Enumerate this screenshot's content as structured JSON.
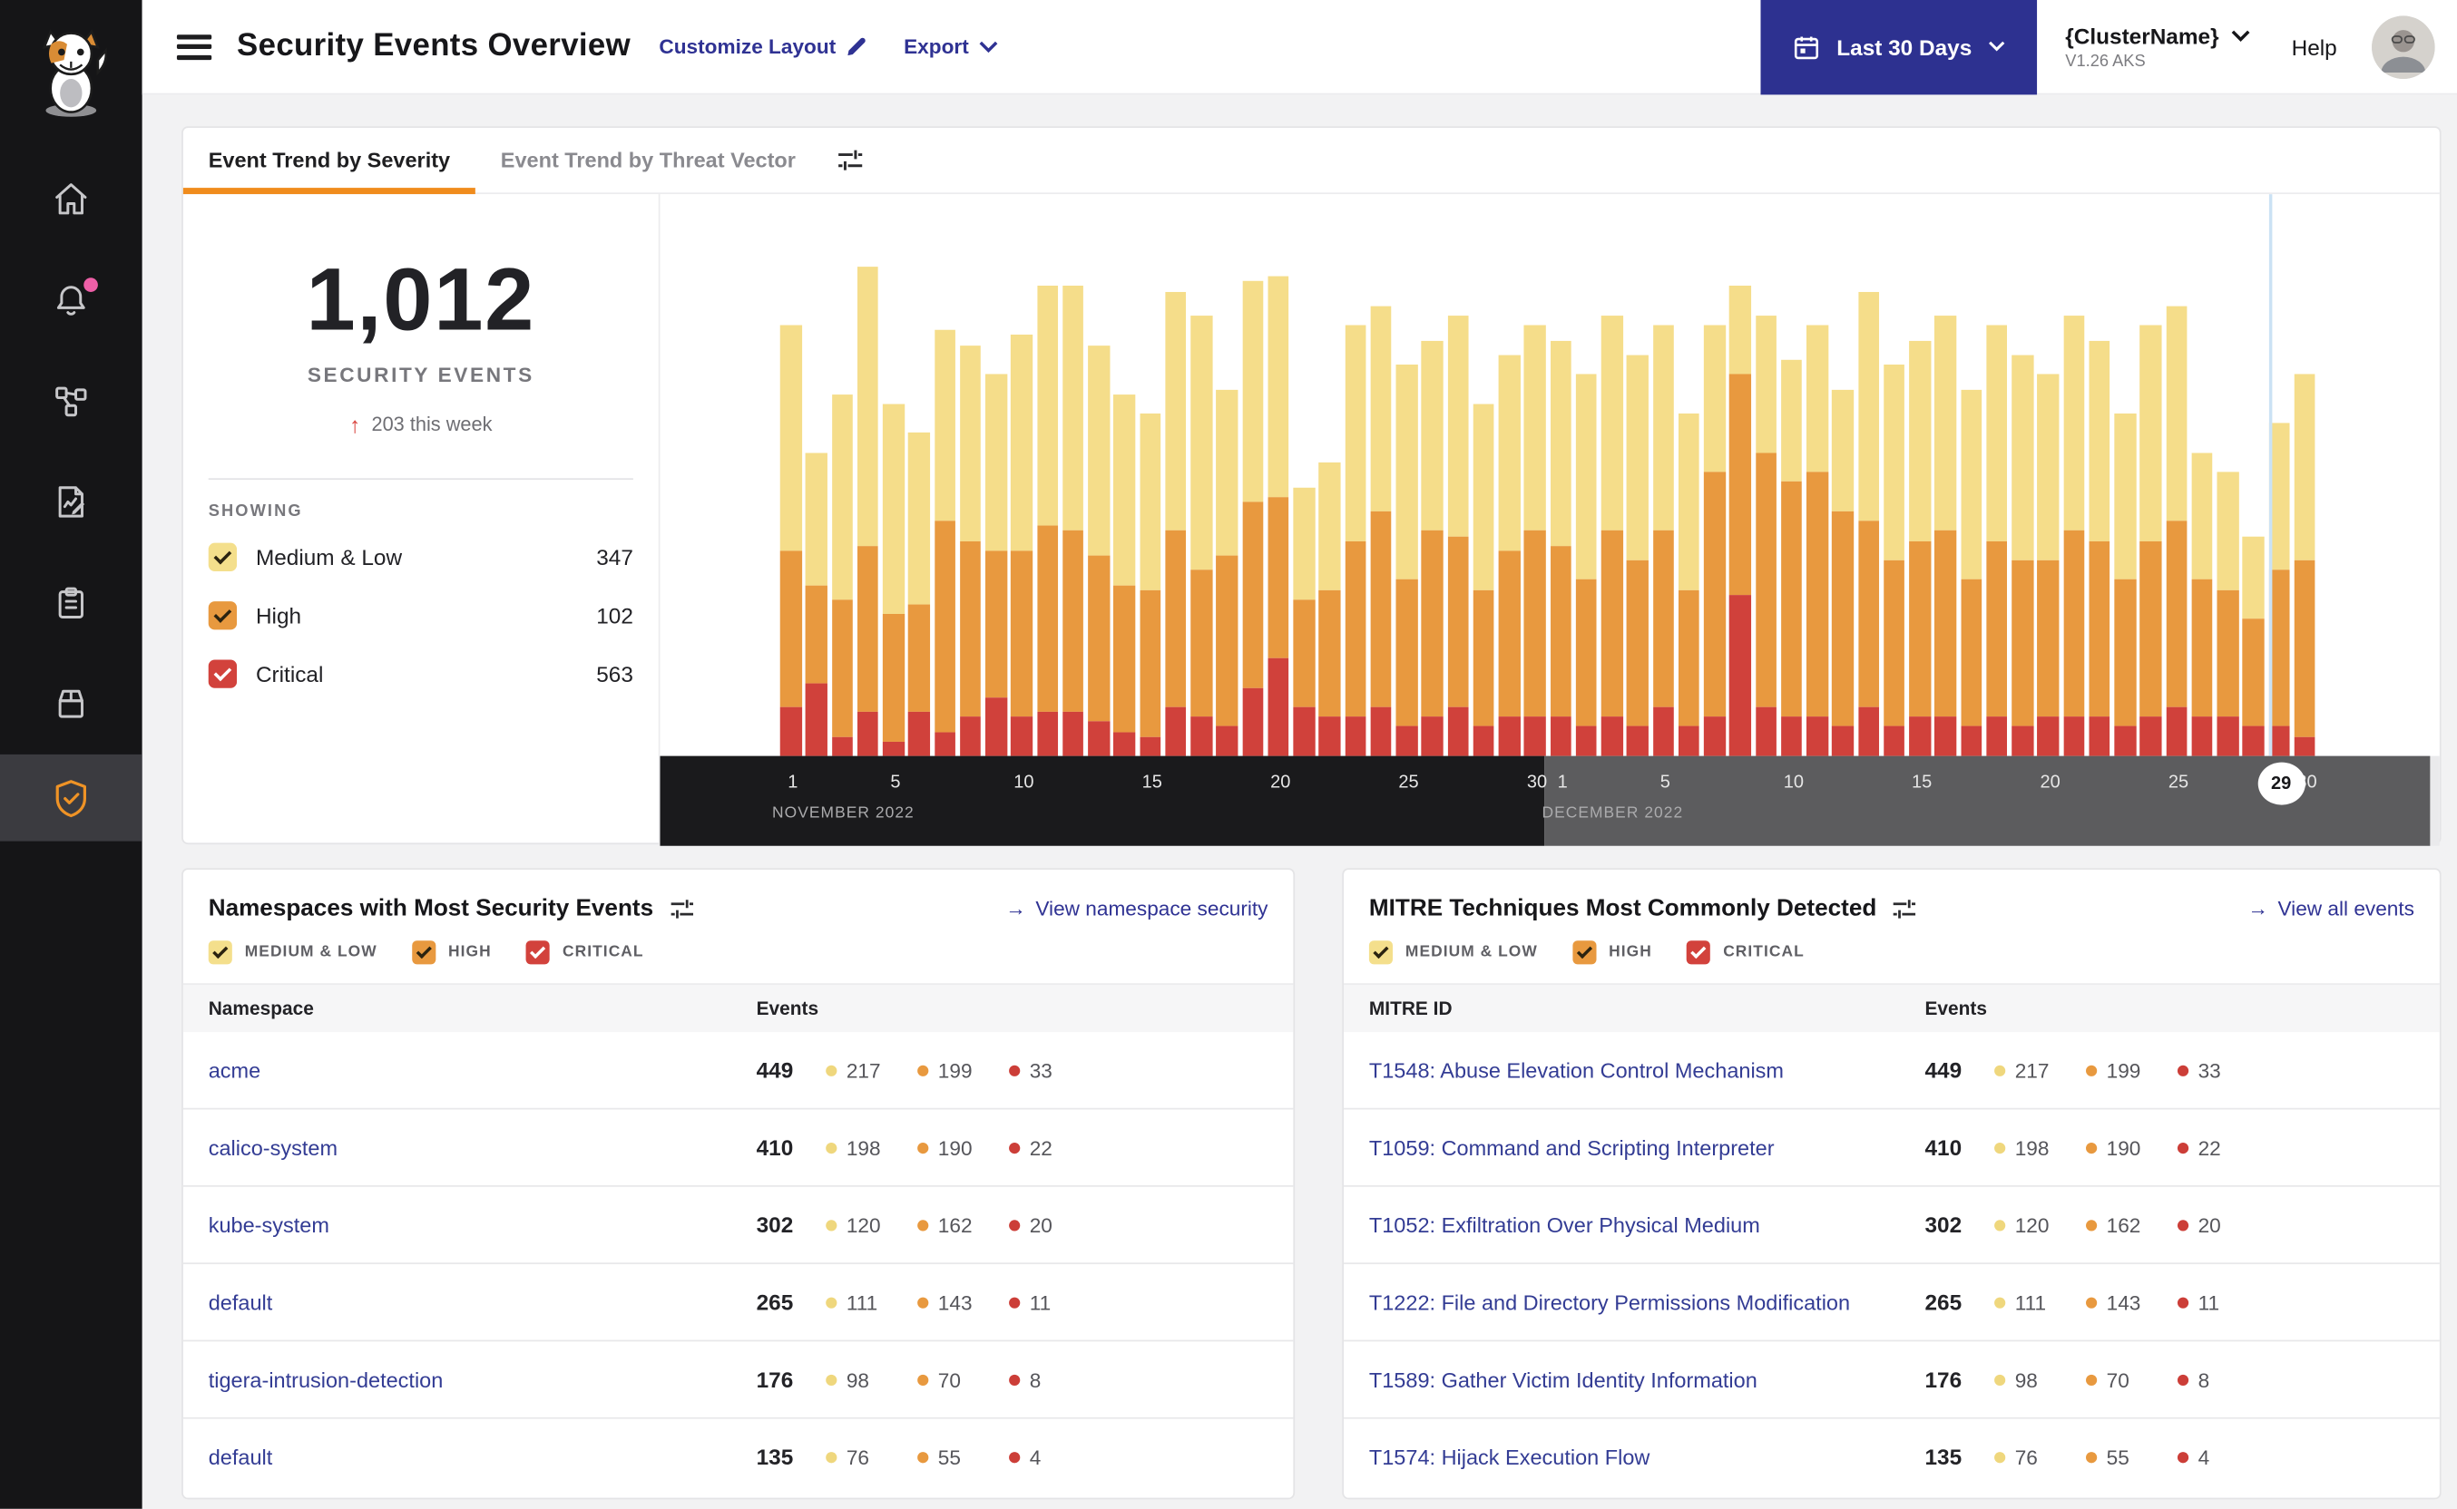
{
  "glyphs": {
    "arrow": "→",
    "up_arrow": "↑"
  },
  "header": {
    "title": "Security Events Overview",
    "customize_label": "Customize Layout",
    "export_label": "Export",
    "date_range_label": "Last 30 Days",
    "cluster_name": "{ClusterName}",
    "cluster_version": "V1.26 AKS",
    "help_label": "Help"
  },
  "sidebar": {
    "items": [
      "calico-cat-logo",
      "home",
      "notifications",
      "service-graph",
      "policies",
      "compliance-reports",
      "workloads",
      "threat-defense"
    ]
  },
  "tabs": [
    {
      "label": "Event Trend by Severity",
      "active": true
    },
    {
      "label": "Event Trend by Threat Vector",
      "active": false
    }
  ],
  "summary": {
    "total": "1,012",
    "label": "SECURITY EVENTS",
    "delta": "203 this week",
    "showing_label": "SHOWING",
    "filters": [
      {
        "label": "Medium & Low",
        "count": "347"
      },
      {
        "label": "High",
        "count": "102"
      },
      {
        "label": "Critical",
        "count": "563"
      }
    ]
  },
  "severity_filters": [
    {
      "id": "medium-low",
      "label": "MEDIUM & LOW",
      "color": "#F4DF8C",
      "check": "dark"
    },
    {
      "id": "high",
      "label": "HIGH",
      "color": "#E8993F",
      "check": "dark"
    },
    {
      "id": "critical",
      "label": "CRITICAL",
      "color": "#D2423C",
      "check": "light"
    }
  ],
  "chart_data": {
    "type": "bar",
    "stacked": true,
    "title": "Event Trend by Severity",
    "legend": [
      "Medium & Low",
      "High",
      "Critical"
    ],
    "colors": {
      "medium_low": "#F5DD8A",
      "high": "#E8993F",
      "critical": "#D0413B"
    },
    "unit": "percent_of_plot_height",
    "x_axis": {
      "months": [
        {
          "label": "NOVEMBER 2022",
          "ticks": [
            1,
            5,
            10,
            15,
            20,
            25,
            30
          ]
        },
        {
          "label": "DECEMBER 2022",
          "ticks": [
            1,
            5,
            10,
            15,
            20,
            25,
            30
          ]
        }
      ],
      "selected": {
        "month_index": 1,
        "day": 29
      }
    },
    "days": [
      {
        "m": "NOV",
        "d": 1,
        "ml": 46,
        "h": 32,
        "c": 10
      },
      {
        "m": "NOV",
        "d": 2,
        "ml": 27,
        "h": 20,
        "c": 15
      },
      {
        "m": "NOV",
        "d": 3,
        "ml": 42,
        "h": 28,
        "c": 4
      },
      {
        "m": "NOV",
        "d": 4,
        "ml": 57,
        "h": 34,
        "c": 9
      },
      {
        "m": "NOV",
        "d": 5,
        "ml": 43,
        "h": 26,
        "c": 3
      },
      {
        "m": "NOV",
        "d": 6,
        "ml": 35,
        "h": 22,
        "c": 9
      },
      {
        "m": "NOV",
        "d": 7,
        "ml": 39,
        "h": 43,
        "c": 5
      },
      {
        "m": "NOV",
        "d": 8,
        "ml": 40,
        "h": 36,
        "c": 8
      },
      {
        "m": "NOV",
        "d": 9,
        "ml": 36,
        "h": 30,
        "c": 12
      },
      {
        "m": "NOV",
        "d": 10,
        "ml": 44,
        "h": 34,
        "c": 8
      },
      {
        "m": "NOV",
        "d": 11,
        "ml": 49,
        "h": 38,
        "c": 9
      },
      {
        "m": "NOV",
        "d": 12,
        "ml": 50,
        "h": 37,
        "c": 9
      },
      {
        "m": "NOV",
        "d": 13,
        "ml": 43,
        "h": 34,
        "c": 7
      },
      {
        "m": "NOV",
        "d": 14,
        "ml": 39,
        "h": 30,
        "c": 5
      },
      {
        "m": "NOV",
        "d": 15,
        "ml": 36,
        "h": 30,
        "c": 4
      },
      {
        "m": "NOV",
        "d": 16,
        "ml": 49,
        "h": 36,
        "c": 10
      },
      {
        "m": "NOV",
        "d": 17,
        "ml": 52,
        "h": 30,
        "c": 8
      },
      {
        "m": "NOV",
        "d": 18,
        "ml": 34,
        "h": 35,
        "c": 6
      },
      {
        "m": "NOV",
        "d": 19,
        "ml": 45,
        "h": 38,
        "c": 14
      },
      {
        "m": "NOV",
        "d": 20,
        "ml": 45,
        "h": 33,
        "c": 20
      },
      {
        "m": "NOV",
        "d": 21,
        "ml": 23,
        "h": 22,
        "c": 10
      },
      {
        "m": "NOV",
        "d": 22,
        "ml": 26,
        "h": 26,
        "c": 8
      },
      {
        "m": "NOV",
        "d": 23,
        "ml": 44,
        "h": 36,
        "c": 8
      },
      {
        "m": "NOV",
        "d": 24,
        "ml": 42,
        "h": 40,
        "c": 10
      },
      {
        "m": "NOV",
        "d": 25,
        "ml": 44,
        "h": 30,
        "c": 6
      },
      {
        "m": "NOV",
        "d": 26,
        "ml": 39,
        "h": 38,
        "c": 8
      },
      {
        "m": "NOV",
        "d": 27,
        "ml": 45,
        "h": 35,
        "c": 10
      },
      {
        "m": "NOV",
        "d": 28,
        "ml": 38,
        "h": 28,
        "c": 6
      },
      {
        "m": "NOV",
        "d": 29,
        "ml": 40,
        "h": 34,
        "c": 8
      },
      {
        "m": "NOV",
        "d": 30,
        "ml": 42,
        "h": 38,
        "c": 8
      },
      {
        "m": "DEC",
        "d": 1,
        "ml": 42,
        "h": 35,
        "c": 8
      },
      {
        "m": "DEC",
        "d": 2,
        "ml": 42,
        "h": 30,
        "c": 6
      },
      {
        "m": "DEC",
        "d": 3,
        "ml": 44,
        "h": 38,
        "c": 8
      },
      {
        "m": "DEC",
        "d": 4,
        "ml": 42,
        "h": 34,
        "c": 6
      },
      {
        "m": "DEC",
        "d": 5,
        "ml": 42,
        "h": 36,
        "c": 10
      },
      {
        "m": "DEC",
        "d": 6,
        "ml": 36,
        "h": 28,
        "c": 6
      },
      {
        "m": "DEC",
        "d": 7,
        "ml": 30,
        "h": 50,
        "c": 8
      },
      {
        "m": "DEC",
        "d": 8,
        "ml": 18,
        "h": 45,
        "c": 33
      },
      {
        "m": "DEC",
        "d": 9,
        "ml": 28,
        "h": 52,
        "c": 10
      },
      {
        "m": "DEC",
        "d": 10,
        "ml": 25,
        "h": 48,
        "c": 8
      },
      {
        "m": "DEC",
        "d": 11,
        "ml": 30,
        "h": 50,
        "c": 8
      },
      {
        "m": "DEC",
        "d": 12,
        "ml": 25,
        "h": 44,
        "c": 6
      },
      {
        "m": "DEC",
        "d": 13,
        "ml": 47,
        "h": 38,
        "c": 10
      },
      {
        "m": "DEC",
        "d": 14,
        "ml": 40,
        "h": 34,
        "c": 6
      },
      {
        "m": "DEC",
        "d": 15,
        "ml": 41,
        "h": 36,
        "c": 8
      },
      {
        "m": "DEC",
        "d": 16,
        "ml": 44,
        "h": 38,
        "c": 8
      },
      {
        "m": "DEC",
        "d": 17,
        "ml": 39,
        "h": 30,
        "c": 6
      },
      {
        "m": "DEC",
        "d": 18,
        "ml": 44,
        "h": 36,
        "c": 8
      },
      {
        "m": "DEC",
        "d": 19,
        "ml": 42,
        "h": 34,
        "c": 6
      },
      {
        "m": "DEC",
        "d": 20,
        "ml": 38,
        "h": 32,
        "c": 8
      },
      {
        "m": "DEC",
        "d": 21,
        "ml": 44,
        "h": 38,
        "c": 8
      },
      {
        "m": "DEC",
        "d": 22,
        "ml": 41,
        "h": 36,
        "c": 8
      },
      {
        "m": "DEC",
        "d": 23,
        "ml": 34,
        "h": 30,
        "c": 6
      },
      {
        "m": "DEC",
        "d": 24,
        "ml": 44,
        "h": 36,
        "c": 8
      },
      {
        "m": "DEC",
        "d": 25,
        "ml": 44,
        "h": 38,
        "c": 10
      },
      {
        "m": "DEC",
        "d": 26,
        "ml": 26,
        "h": 28,
        "c": 8
      },
      {
        "m": "DEC",
        "d": 27,
        "ml": 24,
        "h": 26,
        "c": 8
      },
      {
        "m": "DEC",
        "d": 28,
        "ml": 17,
        "h": 22,
        "c": 6
      },
      {
        "m": "DEC",
        "d": 29,
        "ml": 30,
        "h": 32,
        "c": 6
      },
      {
        "m": "DEC",
        "d": 30,
        "ml": 38,
        "h": 36,
        "c": 4
      }
    ]
  },
  "namespaces_panel": {
    "title": "Namespaces with Most Security Events",
    "link_label": "View namespace security",
    "columns": [
      "Namespace",
      "Events"
    ],
    "rows": [
      {
        "name": "acme",
        "total": 449,
        "medium_low": 217,
        "high": 199,
        "critical": 33
      },
      {
        "name": "calico-system",
        "total": 410,
        "medium_low": 198,
        "high": 190,
        "critical": 22
      },
      {
        "name": "kube-system",
        "total": 302,
        "medium_low": 120,
        "high": 162,
        "critical": 20
      },
      {
        "name": "default",
        "total": 265,
        "medium_low": 111,
        "high": 143,
        "critical": 11
      },
      {
        "name": "tigera-intrusion-detection",
        "total": 176,
        "medium_low": 98,
        "high": 70,
        "critical": 8
      },
      {
        "name": "default",
        "total": 135,
        "medium_low": 76,
        "high": 55,
        "critical": 4
      }
    ]
  },
  "mitre_panel": {
    "title": "MITRE Techniques Most Commonly Detected",
    "link_label": "View all events",
    "columns": [
      "MITRE ID",
      "Events"
    ],
    "rows": [
      {
        "name": "T1548: Abuse Elevation Control Mechanism",
        "total": 449,
        "medium_low": 217,
        "high": 199,
        "critical": 33
      },
      {
        "name": "T1059: Command and Scripting Interpreter",
        "total": 410,
        "medium_low": 198,
        "high": 190,
        "critical": 22
      },
      {
        "name": "T1052: Exfiltration Over Physical Medium",
        "total": 302,
        "medium_low": 120,
        "high": 162,
        "critical": 20
      },
      {
        "name": "T1222: File and Directory Permissions Modification",
        "total": 265,
        "medium_low": 111,
        "high": 143,
        "critical": 11
      },
      {
        "name": "T1589: Gather Victim Identity Information",
        "total": 176,
        "medium_low": 98,
        "high": 70,
        "critical": 8
      },
      {
        "name": "T1574: Hijack Execution Flow",
        "total": 135,
        "medium_low": 76,
        "high": 55,
        "critical": 4
      }
    ]
  }
}
